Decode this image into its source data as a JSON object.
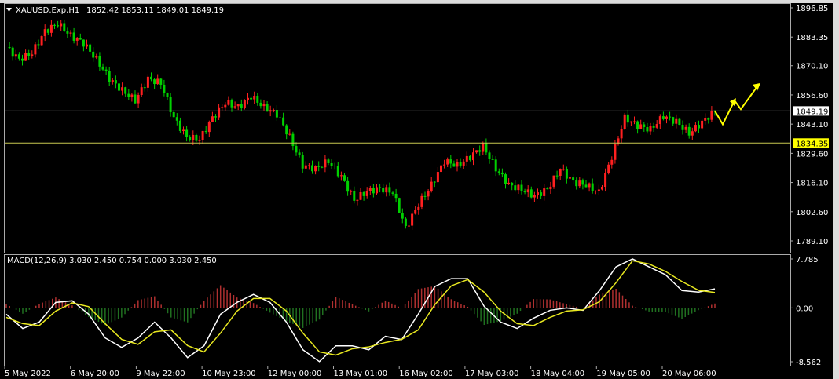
{
  "chart_data": {
    "type": "candlestick",
    "title": "XAUUSD.Exp,H1",
    "ohlc_header": "1852.42 1853.11 1849.01 1849.19",
    "price_ticks": [
      "1896.85",
      "1883.35",
      "1870.10",
      "1856.60",
      "1843.10",
      "1829.60",
      "1816.10",
      "1802.60",
      "1789.10"
    ],
    "price_range": [
      1789.1,
      1896.85
    ],
    "current_price": 1849.19,
    "current_price_label": "1849.19",
    "level_line": 1834.35,
    "level_label": "1834.35",
    "colors": {
      "bull": "#ff2020",
      "bear": "#00d000",
      "level": "#ffff00",
      "bg": "#000000"
    },
    "closes": [
      1878.7,
      1873,
      1876,
      1886,
      1889.6,
      1884,
      1880.5,
      1873,
      1864,
      1858.7,
      1854,
      1864,
      1862,
      1846,
      1837,
      1836,
      1846,
      1853,
      1851,
      1856,
      1851,
      1847.8,
      1837,
      1824,
      1822.5,
      1826,
      1818.8,
      1808,
      1812,
      1813.4,
      1811.6,
      1795,
      1806,
      1815,
      1826,
      1824,
      1828,
      1833,
      1822.5,
      1815,
      1813,
      1809.8,
      1813,
      1822.5,
      1816.3,
      1815,
      1811.6,
      1828,
      1846,
      1842.4,
      1840.6,
      1846.8,
      1844.2,
      1838.8,
      1844,
      1849.2
    ],
    "projection": [
      1849.2,
      1843,
      1854,
      1850,
      1861
    ],
    "x_labels": [
      "5 May 2022",
      "6 May 20:00",
      "9 May 22:00",
      "10 May 23:00",
      "12 May 00:00",
      "13 May 01:00",
      "16 May 02:00",
      "17 May 03:00",
      "18 May 04:00",
      "19 May 05:00",
      "20 May 06:00"
    ],
    "macd": {
      "label": "MACD(12,26,9) 3.030 2.450 0.754 0.000 3.030 2.450",
      "ticks": [
        "7.785",
        "0.00",
        "-8.562"
      ],
      "range": [
        -8.562,
        7.785
      ],
      "main": [
        -1.0,
        -3.27,
        -2.26,
        0.88,
        1.13,
        -1.0,
        -4.77,
        -6.28,
        -4.77,
        -2.26,
        -4.77,
        -7.91,
        -6.03,
        -1.0,
        0.88,
        2.14,
        0.88,
        -2.26,
        -6.66,
        -8.54,
        -6.03,
        -6.03,
        -6.66,
        -4.52,
        -5.03,
        -1.0,
        3.39,
        4.65,
        4.65,
        0.25,
        -2.26,
        -3.27,
        -1.63,
        -0.38,
        0,
        -0.38,
        2.76,
        6.53,
        7.79,
        6.53,
        5.28,
        2.76,
        2.51,
        3.03
      ],
      "signal": [
        -1.5,
        -2.5,
        -2.8,
        -0.5,
        0.8,
        0.2,
        -2.5,
        -5.0,
        -5.8,
        -3.8,
        -3.5,
        -6.0,
        -7.0,
        -4.0,
        -0.5,
        1.5,
        1.5,
        -0.5,
        -4.0,
        -7.0,
        -7.5,
        -6.5,
        -6.2,
        -5.5,
        -5.0,
        -3.5,
        0.5,
        3.5,
        4.5,
        2.5,
        -0.5,
        -2.5,
        -2.8,
        -1.5,
        -0.5,
        -0.3,
        1.0,
        4.0,
        7.5,
        7.0,
        5.8,
        4.2,
        2.8,
        2.45
      ]
    }
  }
}
